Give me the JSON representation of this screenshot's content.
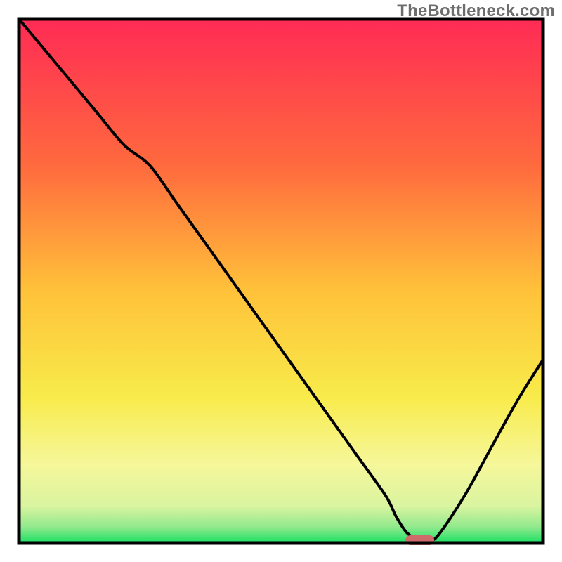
{
  "watermark": "TheBottleneck.com",
  "colors": {
    "top": "#ff2b55",
    "mid_upper": "#ff8b36",
    "mid": "#ffd23a",
    "mid_lower": "#f7f485",
    "green": "#19e064",
    "curve": "#000000",
    "marker": "#cf6a6a",
    "border": "#000000"
  },
  "chart_data": {
    "type": "line",
    "title": "",
    "xlabel": "",
    "ylabel": "",
    "xlim": [
      0,
      100
    ],
    "ylim": [
      0,
      100
    ],
    "x": [
      0,
      5,
      10,
      15,
      20,
      25,
      30,
      35,
      40,
      45,
      50,
      55,
      60,
      65,
      70,
      72,
      74,
      76,
      78,
      80,
      85,
      90,
      95,
      100
    ],
    "values": [
      100,
      94,
      88,
      82,
      76,
      72,
      65,
      58,
      51,
      44,
      37,
      30,
      23,
      16,
      9,
      5,
      2,
      0.7,
      0.5,
      1.5,
      9,
      18,
      27,
      35
    ],
    "minimum": {
      "x": 76.5,
      "y": 0.5
    },
    "marker": {
      "x_center": 76.5,
      "width": 5.5
    },
    "grid": false,
    "legend": false
  }
}
